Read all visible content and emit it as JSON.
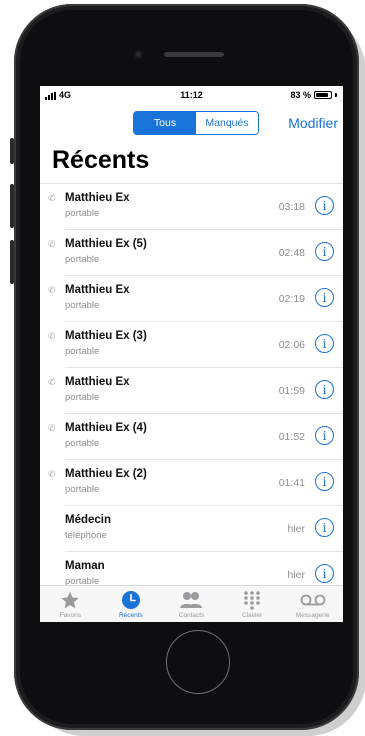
{
  "status_bar": {
    "carrier": "4G",
    "time": "11:12",
    "battery_text": "83 %",
    "battery_level": 0.83
  },
  "segmented_control": {
    "selected": "Tous",
    "options": [
      "Tous",
      "Manqués"
    ]
  },
  "header": {
    "edit_label": "Modifier",
    "title": "Récents"
  },
  "calls": [
    {
      "name": "Matthieu Ex",
      "type": "portable",
      "time": "03:18",
      "icon": "phone-outgoing-icon"
    },
    {
      "name": "Matthieu Ex (5)",
      "type": "portable",
      "time": "02:48",
      "icon": "phone-outgoing-icon"
    },
    {
      "name": "Matthieu Ex",
      "type": "portable",
      "time": "02:19",
      "icon": "phone-outgoing-icon"
    },
    {
      "name": "Matthieu Ex (3)",
      "type": "portable",
      "time": "02:06",
      "icon": "phone-outgoing-icon"
    },
    {
      "name": "Matthieu Ex",
      "type": "portable",
      "time": "01:59",
      "icon": "phone-outgoing-icon"
    },
    {
      "name": "Matthieu Ex (4)",
      "type": "portable",
      "time": "01:52",
      "icon": "phone-outgoing-icon"
    },
    {
      "name": "Matthieu Ex (2)",
      "type": "portable",
      "time": "01:41",
      "icon": "phone-outgoing-icon"
    },
    {
      "name": "Médecin",
      "type": "téléphone",
      "time": "hier",
      "icon": ""
    },
    {
      "name": "Maman",
      "type": "portable",
      "time": "hier",
      "icon": ""
    }
  ],
  "info_glyph": "i",
  "tab_bar": {
    "active": "Récents",
    "tabs": [
      {
        "label": "Favoris",
        "icon": "star-icon"
      },
      {
        "label": "Récents",
        "icon": "clock-icon"
      },
      {
        "label": "Contacts",
        "icon": "contacts-icon"
      },
      {
        "label": "Clavier",
        "icon": "keypad-icon"
      },
      {
        "label": "Messagerie",
        "icon": "voicemail-icon"
      }
    ]
  },
  "colors": {
    "accent": "#1a73d8",
    "inactive_tab": "#9b9b9f",
    "secondary_text": "#8e8e93"
  }
}
